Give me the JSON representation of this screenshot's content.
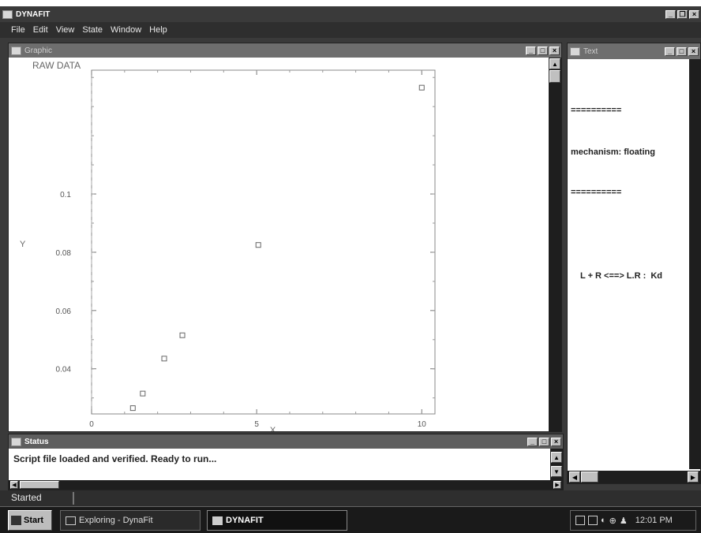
{
  "app": {
    "title": "DYNAFIT",
    "title_buttons": [
      "minimize",
      "restore",
      "close"
    ]
  },
  "menubar": {
    "items": [
      "File",
      "Edit",
      "View",
      "State",
      "Window",
      "Help"
    ]
  },
  "graphic_window": {
    "title": "Graphic"
  },
  "chart_data": {
    "type": "scatter",
    "title": "RAW DATA",
    "xlabel": "X",
    "ylabel": "Y",
    "xlim": [
      0,
      10.4
    ],
    "ylim": [
      0.0245,
      0.1425
    ],
    "x_ticks": [
      "0",
      "5",
      "10"
    ],
    "y_ticks": [
      "0.1",
      "0.08",
      "0.06",
      "0.04"
    ],
    "points": [
      {
        "x": 1.25,
        "y": 0.0265
      },
      {
        "x": 1.55,
        "y": 0.0315
      },
      {
        "x": 2.2,
        "y": 0.0435
      },
      {
        "x": 2.75,
        "y": 0.0515
      },
      {
        "x": 5.05,
        "y": 0.0825
      },
      {
        "x": 10.0,
        "y": 0.1365
      }
    ]
  },
  "text_window": {
    "title": "Text",
    "lines": [
      "==========",
      "mechanism: floating",
      "==========",
      "",
      "L + R <==> L.R :  Kd"
    ]
  },
  "status_window": {
    "title": "Status",
    "message": "Script file loaded and verified. Ready to run..."
  },
  "statusbar": {
    "text": "Started"
  },
  "taskbar": {
    "start_label": "Start",
    "tasks": [
      {
        "label": "Exploring - DynaFit",
        "active": false
      },
      {
        "label": "DYNAFIT",
        "active": true
      }
    ],
    "clock": "12:01 PM"
  }
}
